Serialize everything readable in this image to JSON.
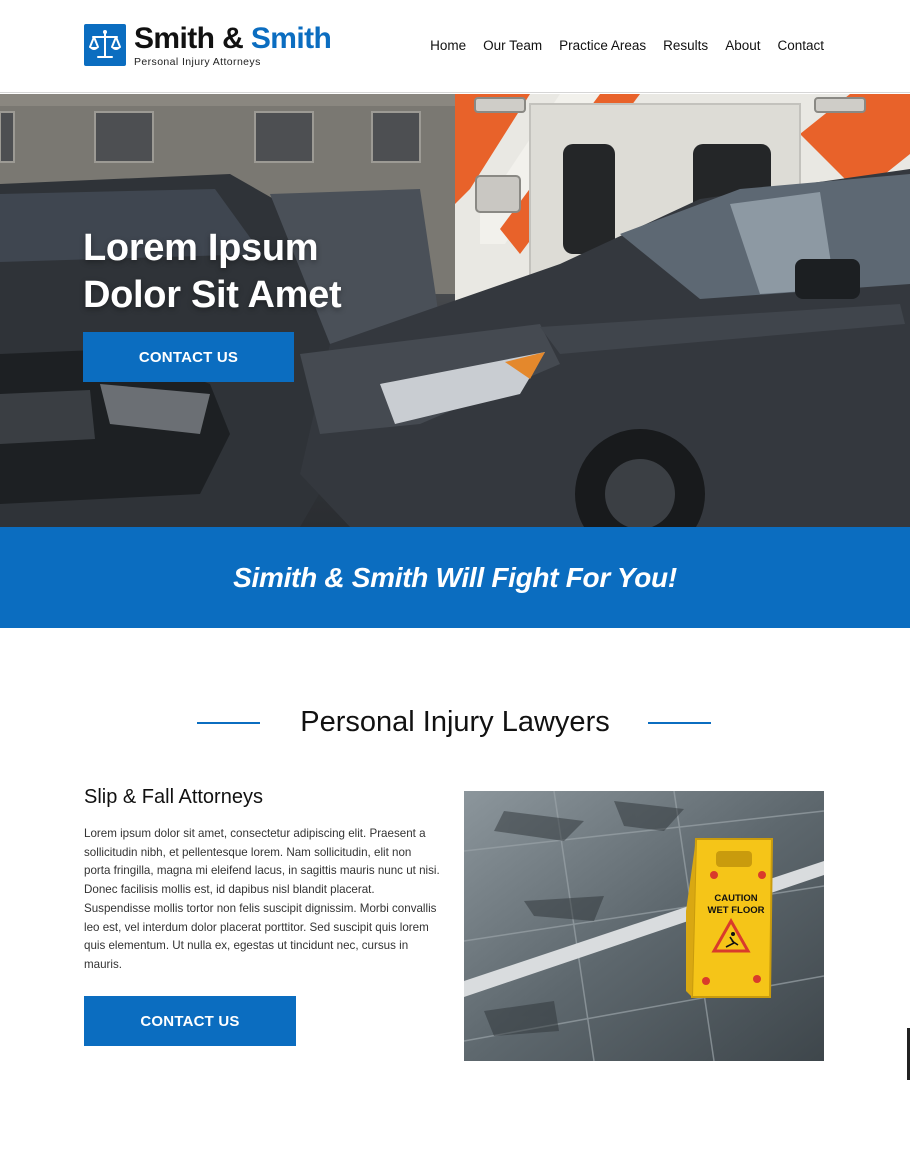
{
  "brand": {
    "name_part1": "Smith & ",
    "name_part2": "Smith",
    "tagline": "Personal Injury Attorneys",
    "logo_icon": "scales-of-justice-icon",
    "primary_color": "#0b6dc0"
  },
  "nav": {
    "items": [
      {
        "label": "Home"
      },
      {
        "label": "Our Team"
      },
      {
        "label": "Practice Areas"
      },
      {
        "label": "Results"
      },
      {
        "label": "About"
      },
      {
        "label": "Contact"
      }
    ]
  },
  "hero": {
    "title_line1": "Lorem Ipsum",
    "title_line2": "Dolor Sit Amet",
    "cta_label": "CONTACT US"
  },
  "banner": {
    "text": "Simith & Smith Will Fight For You!"
  },
  "section": {
    "heading": "Personal Injury Lawyers",
    "subtitle": "Slip & Fall Attorneys",
    "body": "Lorem ipsum dolor sit amet, consectetur adipiscing elit. Praesent a sollicitudin nibh, et pellentesque lorem. Nam sollicitudin, elit non porta fringilla, magna mi eleifend lacus, in sagittis mauris nunc ut nisi. Donec facilisis mollis est, id dapibus nisl blandit placerat. Suspendisse mollis tortor non felis suscipit dignissim. Morbi convallis leo est, vel interdum dolor placerat porttitor. Sed suscipit quis lorem quis elementum. Ut nulla ex, egestas ut tincidunt nec, cursus in mauris.",
    "cta_label": "CONTACT US",
    "sign_line1": "CAUTION",
    "sign_line2": "WET FLOOR"
  }
}
